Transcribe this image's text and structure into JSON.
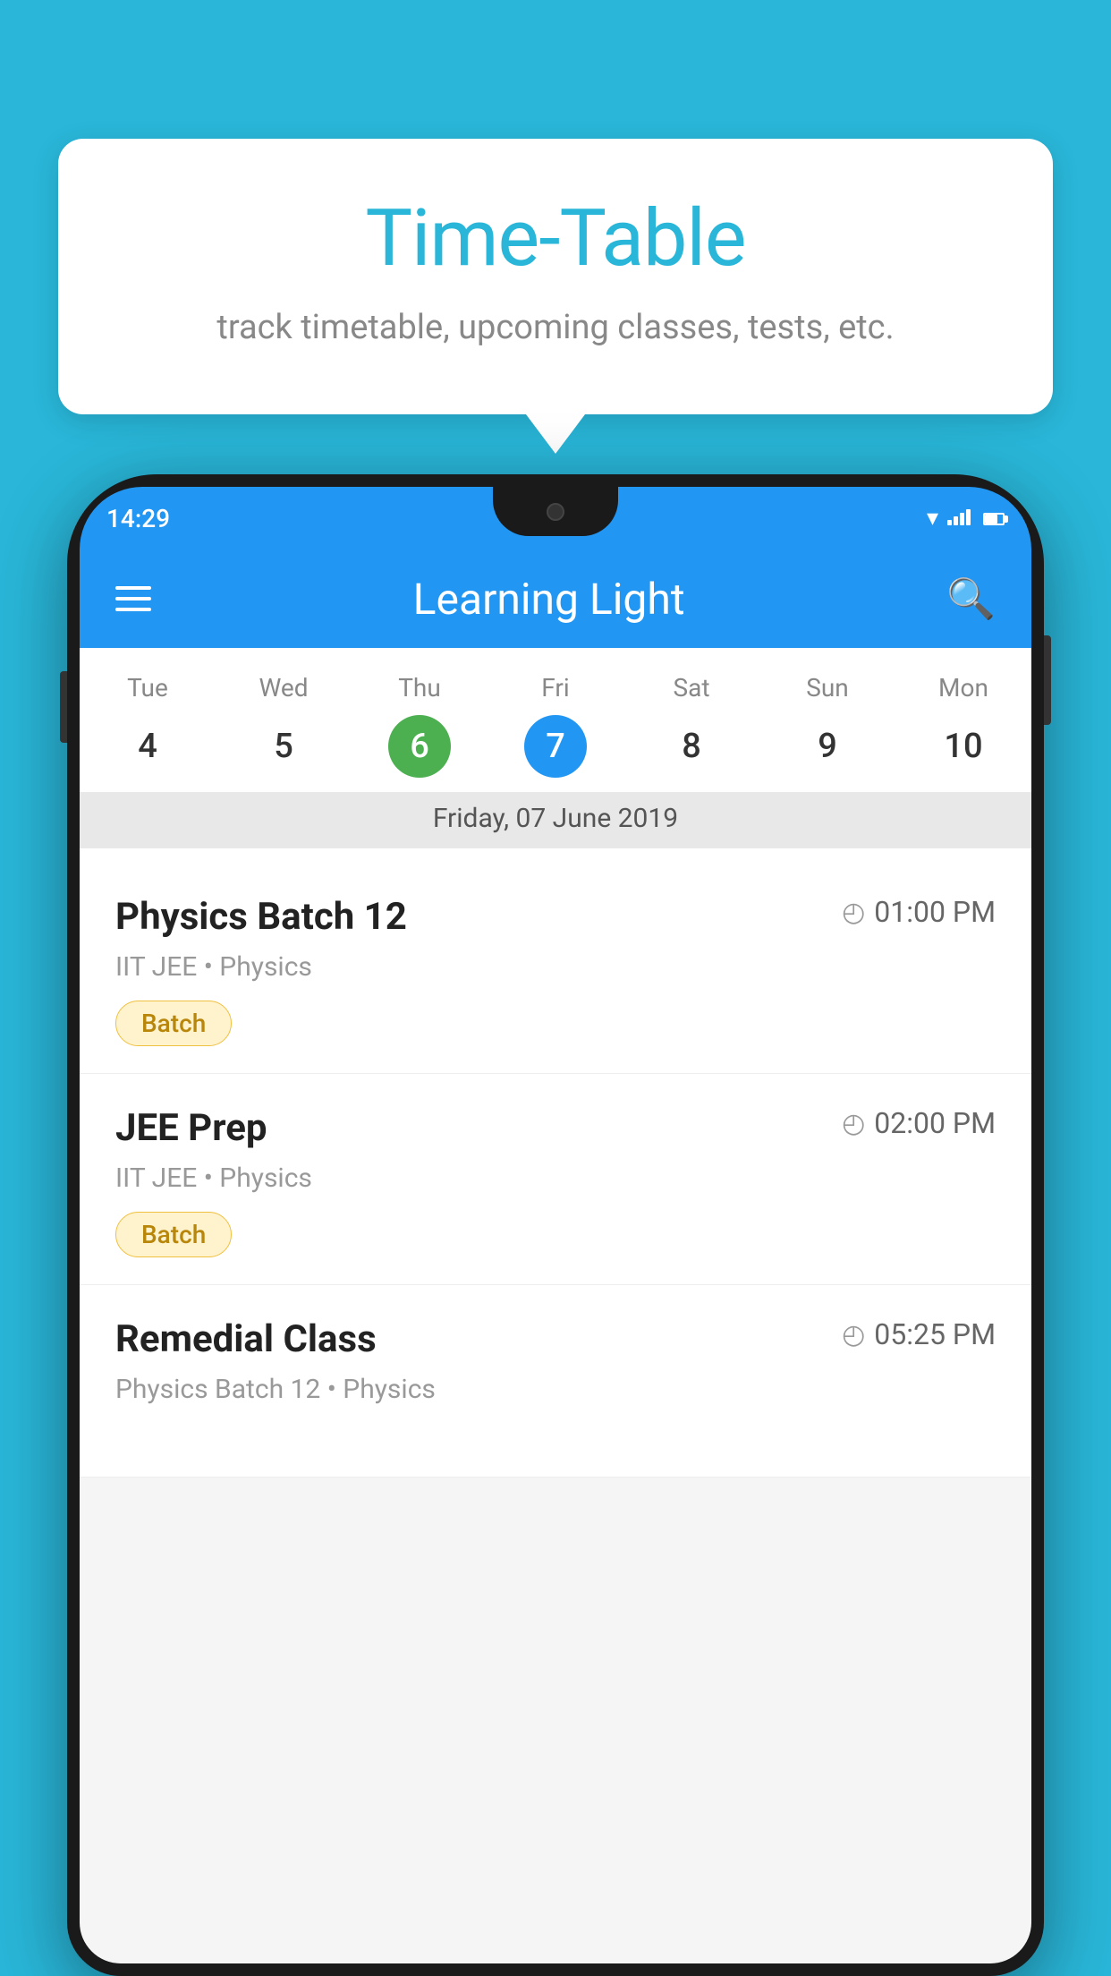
{
  "background": {
    "color": "#29B6D8"
  },
  "tooltip": {
    "title": "Time-Table",
    "subtitle": "track timetable, upcoming classes, tests, etc."
  },
  "phone": {
    "status_bar": {
      "time": "14:29"
    },
    "app_header": {
      "title": "Learning Light"
    },
    "calendar": {
      "days": [
        {
          "label": "Tue",
          "num": "4",
          "state": "normal"
        },
        {
          "label": "Wed",
          "num": "5",
          "state": "normal"
        },
        {
          "label": "Thu",
          "num": "6",
          "state": "today"
        },
        {
          "label": "Fri",
          "num": "7",
          "state": "selected"
        },
        {
          "label": "Sat",
          "num": "8",
          "state": "normal"
        },
        {
          "label": "Sun",
          "num": "9",
          "state": "normal"
        },
        {
          "label": "Mon",
          "num": "10",
          "state": "normal"
        }
      ],
      "selected_date_label": "Friday, 07 June 2019"
    },
    "schedule": {
      "items": [
        {
          "title": "Physics Batch 12",
          "time": "01:00 PM",
          "subject": "IIT JEE • Physics",
          "badge": "Batch"
        },
        {
          "title": "JEE Prep",
          "time": "02:00 PM",
          "subject": "IIT JEE • Physics",
          "badge": "Batch"
        },
        {
          "title": "Remedial Class",
          "time": "05:25 PM",
          "subject": "Physics Batch 12 • Physics",
          "badge": null
        }
      ]
    }
  }
}
